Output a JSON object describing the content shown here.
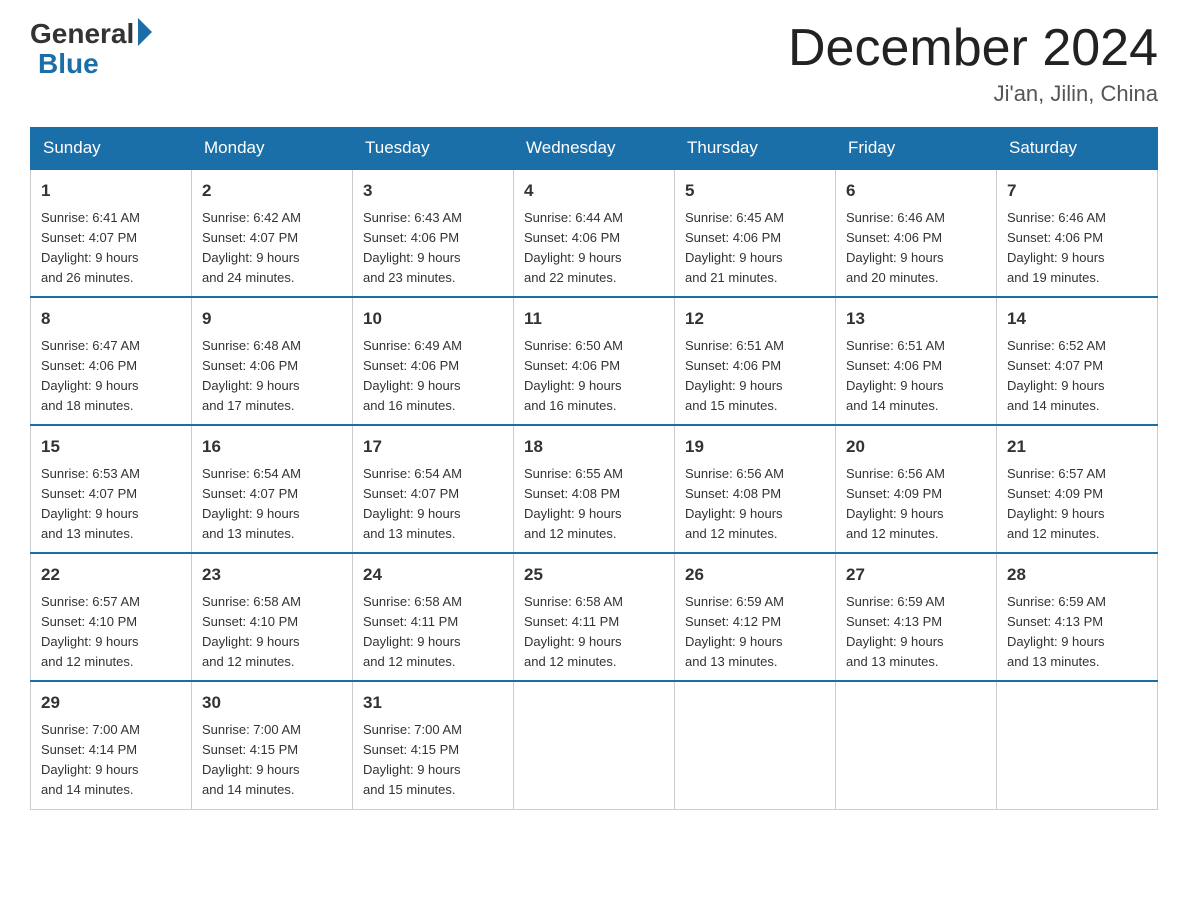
{
  "header": {
    "logo_text_general": "General",
    "logo_text_blue": "Blue",
    "main_title": "December 2024",
    "subtitle": "Ji'an, Jilin, China"
  },
  "calendar": {
    "days_of_week": [
      "Sunday",
      "Monday",
      "Tuesday",
      "Wednesday",
      "Thursday",
      "Friday",
      "Saturday"
    ],
    "weeks": [
      [
        {
          "day": "1",
          "sunrise": "6:41 AM",
          "sunset": "4:07 PM",
          "daylight": "9 hours and 26 minutes."
        },
        {
          "day": "2",
          "sunrise": "6:42 AM",
          "sunset": "4:07 PM",
          "daylight": "9 hours and 24 minutes."
        },
        {
          "day": "3",
          "sunrise": "6:43 AM",
          "sunset": "4:06 PM",
          "daylight": "9 hours and 23 minutes."
        },
        {
          "day": "4",
          "sunrise": "6:44 AM",
          "sunset": "4:06 PM",
          "daylight": "9 hours and 22 minutes."
        },
        {
          "day": "5",
          "sunrise": "6:45 AM",
          "sunset": "4:06 PM",
          "daylight": "9 hours and 21 minutes."
        },
        {
          "day": "6",
          "sunrise": "6:46 AM",
          "sunset": "4:06 PM",
          "daylight": "9 hours and 20 minutes."
        },
        {
          "day": "7",
          "sunrise": "6:46 AM",
          "sunset": "4:06 PM",
          "daylight": "9 hours and 19 minutes."
        }
      ],
      [
        {
          "day": "8",
          "sunrise": "6:47 AM",
          "sunset": "4:06 PM",
          "daylight": "9 hours and 18 minutes."
        },
        {
          "day": "9",
          "sunrise": "6:48 AM",
          "sunset": "4:06 PM",
          "daylight": "9 hours and 17 minutes."
        },
        {
          "day": "10",
          "sunrise": "6:49 AM",
          "sunset": "4:06 PM",
          "daylight": "9 hours and 16 minutes."
        },
        {
          "day": "11",
          "sunrise": "6:50 AM",
          "sunset": "4:06 PM",
          "daylight": "9 hours and 16 minutes."
        },
        {
          "day": "12",
          "sunrise": "6:51 AM",
          "sunset": "4:06 PM",
          "daylight": "9 hours and 15 minutes."
        },
        {
          "day": "13",
          "sunrise": "6:51 AM",
          "sunset": "4:06 PM",
          "daylight": "9 hours and 14 minutes."
        },
        {
          "day": "14",
          "sunrise": "6:52 AM",
          "sunset": "4:07 PM",
          "daylight": "9 hours and 14 minutes."
        }
      ],
      [
        {
          "day": "15",
          "sunrise": "6:53 AM",
          "sunset": "4:07 PM",
          "daylight": "9 hours and 13 minutes."
        },
        {
          "day": "16",
          "sunrise": "6:54 AM",
          "sunset": "4:07 PM",
          "daylight": "9 hours and 13 minutes."
        },
        {
          "day": "17",
          "sunrise": "6:54 AM",
          "sunset": "4:07 PM",
          "daylight": "9 hours and 13 minutes."
        },
        {
          "day": "18",
          "sunrise": "6:55 AM",
          "sunset": "4:08 PM",
          "daylight": "9 hours and 12 minutes."
        },
        {
          "day": "19",
          "sunrise": "6:56 AM",
          "sunset": "4:08 PM",
          "daylight": "9 hours and 12 minutes."
        },
        {
          "day": "20",
          "sunrise": "6:56 AM",
          "sunset": "4:09 PM",
          "daylight": "9 hours and 12 minutes."
        },
        {
          "day": "21",
          "sunrise": "6:57 AM",
          "sunset": "4:09 PM",
          "daylight": "9 hours and 12 minutes."
        }
      ],
      [
        {
          "day": "22",
          "sunrise": "6:57 AM",
          "sunset": "4:10 PM",
          "daylight": "9 hours and 12 minutes."
        },
        {
          "day": "23",
          "sunrise": "6:58 AM",
          "sunset": "4:10 PM",
          "daylight": "9 hours and 12 minutes."
        },
        {
          "day": "24",
          "sunrise": "6:58 AM",
          "sunset": "4:11 PM",
          "daylight": "9 hours and 12 minutes."
        },
        {
          "day": "25",
          "sunrise": "6:58 AM",
          "sunset": "4:11 PM",
          "daylight": "9 hours and 12 minutes."
        },
        {
          "day": "26",
          "sunrise": "6:59 AM",
          "sunset": "4:12 PM",
          "daylight": "9 hours and 13 minutes."
        },
        {
          "day": "27",
          "sunrise": "6:59 AM",
          "sunset": "4:13 PM",
          "daylight": "9 hours and 13 minutes."
        },
        {
          "day": "28",
          "sunrise": "6:59 AM",
          "sunset": "4:13 PM",
          "daylight": "9 hours and 13 minutes."
        }
      ],
      [
        {
          "day": "29",
          "sunrise": "7:00 AM",
          "sunset": "4:14 PM",
          "daylight": "9 hours and 14 minutes."
        },
        {
          "day": "30",
          "sunrise": "7:00 AM",
          "sunset": "4:15 PM",
          "daylight": "9 hours and 14 minutes."
        },
        {
          "day": "31",
          "sunrise": "7:00 AM",
          "sunset": "4:15 PM",
          "daylight": "9 hours and 15 minutes."
        },
        null,
        null,
        null,
        null
      ]
    ]
  }
}
